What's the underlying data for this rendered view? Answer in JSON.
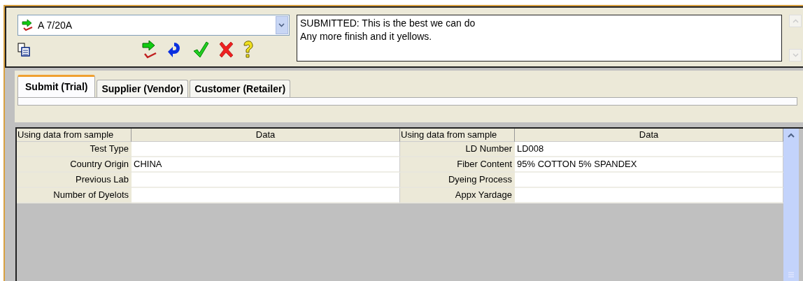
{
  "selector": {
    "value": "A 7/20A"
  },
  "notes": {
    "lines": [
      "SUBMITTED: This is the best we can do",
      "Any more finish and it yellows."
    ]
  },
  "tabs": [
    {
      "label": "Submit (Trial)",
      "selected": true
    },
    {
      "label": "Supplier (Vendor)",
      "selected": false
    },
    {
      "label": "Customer (Retailer)",
      "selected": false
    }
  ],
  "grids": [
    {
      "columns": [
        "Using data from sample",
        "Data"
      ],
      "rows": [
        {
          "label": "Test Type",
          "value": ""
        },
        {
          "label": "Country Origin",
          "value": "CHINA"
        },
        {
          "label": "Previous Lab",
          "value": ""
        },
        {
          "label": "Number of Dyelots",
          "value": ""
        }
      ]
    },
    {
      "columns": [
        "Using data from sample",
        "Data"
      ],
      "rows": [
        {
          "label": "LD Number",
          "value": "LD008"
        },
        {
          "label": "Fiber Content",
          "value": "95% COTTON 5% SPANDEX"
        },
        {
          "label": "Dyeing Process",
          "value": ""
        },
        {
          "label": "Appx Yardage",
          "value": ""
        }
      ]
    }
  ]
}
